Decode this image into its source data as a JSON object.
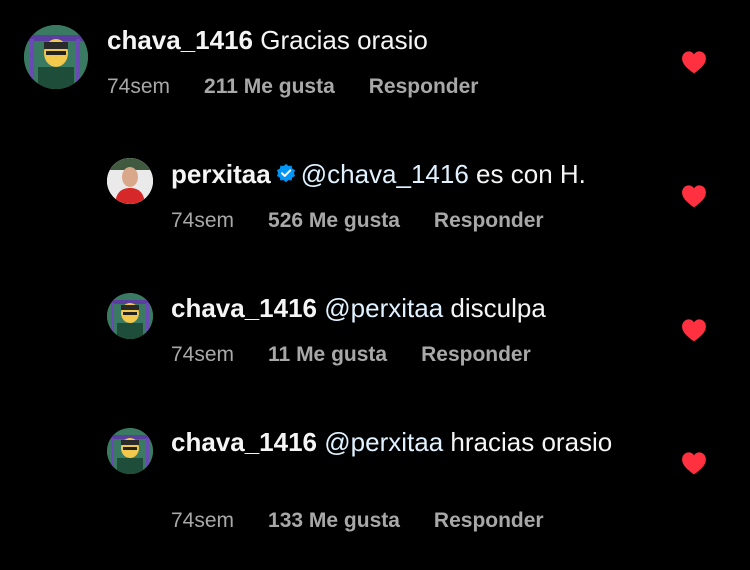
{
  "colors": {
    "background": "#000000",
    "text": "#f5f5f5",
    "meta": "#a8a8a8",
    "mention": "#e0f1ff",
    "heart": "#ff3040",
    "verified": "#0095f6"
  },
  "comments": [
    {
      "username": "chava_1416",
      "mention": "",
      "text": "Gracias orasio",
      "time": "74sem",
      "likes": "211 Me gusta",
      "reply": "Responder",
      "heart_icon": "heart-filled-icon"
    },
    {
      "username": "perxitaa",
      "verified_icon": "verified-badge-icon",
      "mention": "@chava_1416",
      "text": "es con H.",
      "time": "74sem",
      "likes": "526 Me gusta",
      "reply": "Responder",
      "heart_icon": "heart-filled-icon"
    },
    {
      "username": "chava_1416",
      "mention": "@perxitaa",
      "text": "disculpa",
      "time": "74sem",
      "likes": "11 Me gusta",
      "reply": "Responder",
      "heart_icon": "heart-filled-icon"
    },
    {
      "username": "chava_1416",
      "mention": "@perxitaa",
      "text": "hracias orasio",
      "time": "74sem",
      "likes": "133 Me gusta",
      "reply": "Responder",
      "heart_icon": "heart-filled-icon"
    }
  ]
}
